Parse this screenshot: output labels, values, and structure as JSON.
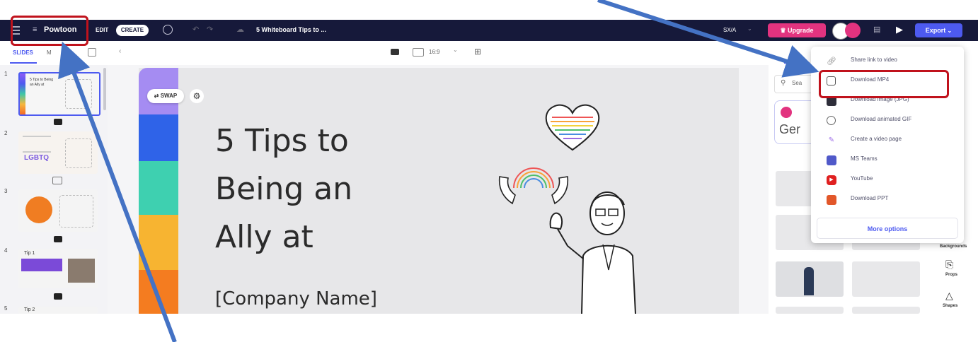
{
  "topbar": {
    "brand": "Powtoon",
    "edit": "EDIT",
    "create": "CREATE",
    "doc_title": "5 Whiteboard Tips to ...",
    "zoom": "SX/A",
    "upgrade": "Upgrade",
    "export": "Export"
  },
  "subbar": {
    "tab_slides": "SLIDES",
    "tab_more": "M",
    "ratio": "16:9"
  },
  "slides": {
    "s1_num": "1",
    "s1_text": "5 Tips to Being an Ally at",
    "s2_num": "2",
    "s2_text": "LGBTQ",
    "s3_num": "3",
    "s4_num": "4",
    "s4_title": "Tip 1",
    "s5_num": "5",
    "s5_title": "Tip 2"
  },
  "slide_content": {
    "swap": "SWAP",
    "title_line1": "5 Tips to",
    "title_line2": "Being an",
    "title_line3": "Ally at",
    "subtitle": "[Company Name]"
  },
  "right_panel": {
    "search_placeholder": "Sea",
    "gen_text": "Ger",
    "side_buttons": "Backgrounds",
    "props": "Props",
    "shapes": "Shapes"
  },
  "export_menu": {
    "items": [
      {
        "label": "Share link to video",
        "icon": "link-icon"
      },
      {
        "label": "Download MP4",
        "icon": "video-file-icon"
      },
      {
        "label": "Download image (JPG)",
        "icon": "image-icon"
      },
      {
        "label": "Download animated GIF",
        "icon": "gif-icon"
      },
      {
        "label": "Create a video page",
        "icon": "page-icon"
      },
      {
        "label": "MS Teams",
        "icon": "teams-icon"
      },
      {
        "label": "YouTube",
        "icon": "youtube-icon"
      },
      {
        "label": "Download PPT",
        "icon": "ppt-icon"
      }
    ],
    "more": "More options"
  },
  "colors": {
    "topbar": "#16193a",
    "accent": "#4d5af0",
    "upgrade": "#e2337f",
    "annotation_red": "#c0121c",
    "annotation_arrow": "#4472c4"
  }
}
